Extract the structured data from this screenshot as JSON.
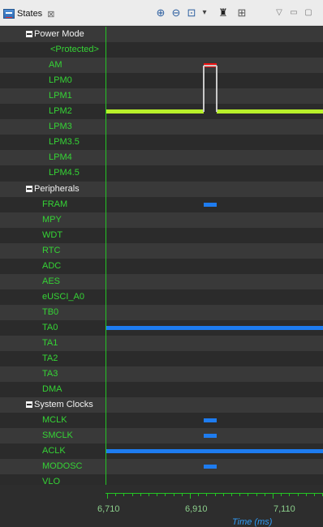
{
  "tab": {
    "title": "States",
    "close_symbol": "⊠"
  },
  "toolbar": {
    "zoom_in": "⊕",
    "zoom_out": "⊖",
    "zoom_fit": "⊡",
    "dropdown": "▾",
    "find": "♜",
    "columns": "⊞",
    "menu": "▽",
    "minimize": "▭",
    "maximize": "▢"
  },
  "rows": [
    {
      "label": "Power Mode",
      "group": true
    },
    {
      "label": "<Protected>"
    },
    {
      "label": "AM"
    },
    {
      "label": "LPM0"
    },
    {
      "label": "LPM1"
    },
    {
      "label": "LPM2"
    },
    {
      "label": "LPM3"
    },
    {
      "label": "LPM3.5"
    },
    {
      "label": "LPM4"
    },
    {
      "label": "LPM4.5"
    },
    {
      "label": "Peripherals",
      "group": true
    },
    {
      "label": "FRAM"
    },
    {
      "label": "MPY"
    },
    {
      "label": "WDT"
    },
    {
      "label": "RTC"
    },
    {
      "label": "ADC"
    },
    {
      "label": "AES"
    },
    {
      "label": "eUSCI_A0"
    },
    {
      "label": "TB0"
    },
    {
      "label": "TA0"
    },
    {
      "label": "TA1"
    },
    {
      "label": "TA2"
    },
    {
      "label": "TA3"
    },
    {
      "label": "DMA"
    },
    {
      "label": "System Clocks",
      "group": true
    },
    {
      "label": "MCLK"
    },
    {
      "label": "SMCLK"
    },
    {
      "label": "ACLK"
    },
    {
      "label": "MODOSC"
    },
    {
      "label": "VLO"
    }
  ],
  "segments": [
    {
      "row": "AM",
      "start": 6932,
      "end": 6960,
      "color": "#ee1111"
    },
    {
      "row": "LPM2",
      "start": 6710,
      "end": 6932,
      "color": "#b8f02a"
    },
    {
      "row": "LPM2",
      "start": 6960,
      "end": 7200,
      "color": "#b8f02a"
    },
    {
      "row": "FRAM",
      "start": 6932,
      "end": 6960,
      "color": "#1e7cf0"
    },
    {
      "row": "TA0",
      "start": 6710,
      "end": 7200,
      "color": "#1e7cf0"
    },
    {
      "row": "MCLK",
      "start": 6932,
      "end": 6960,
      "color": "#1e7cf0"
    },
    {
      "row": "SMCLK",
      "start": 6932,
      "end": 6960,
      "color": "#1e7cf0"
    },
    {
      "row": "ACLK",
      "start": 6710,
      "end": 7200,
      "color": "#1e7cf0"
    },
    {
      "row": "MODOSC",
      "start": 6932,
      "end": 6960,
      "color": "#1e7cf0"
    }
  ],
  "axis": {
    "start": 6710,
    "end": 7200,
    "ticks": [
      "6,710",
      "6,910",
      "7,110"
    ],
    "title": "Time (ms)"
  }
}
